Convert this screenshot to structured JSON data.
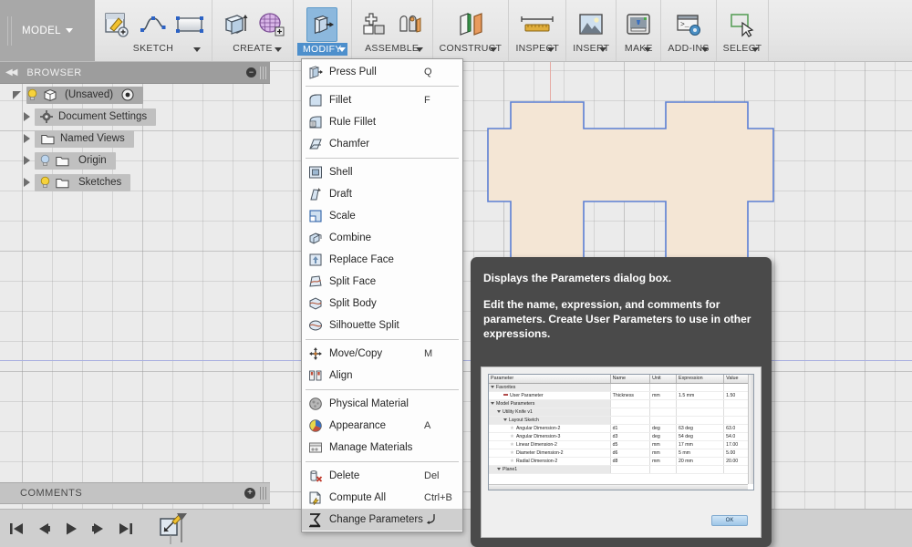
{
  "app": {
    "workspace_tab": "MODEL",
    "accent_blue": "#4d8fcc",
    "canvas_bg": "#ebebeb"
  },
  "toolbar": {
    "groups": [
      {
        "label": "SKETCH",
        "icons": [
          "create-sketch-icon",
          "spline-icon",
          "rectangle-icon"
        ]
      },
      {
        "label": "CREATE",
        "icons": [
          "extrude-icon",
          "form-icon"
        ]
      },
      {
        "label": "MODIFY",
        "icons": [
          "press-pull-icon"
        ],
        "active": true
      },
      {
        "label": "ASSEMBLE",
        "icons": [
          "new-component-icon",
          "joint-icon"
        ]
      },
      {
        "label": "CONSTRUCT",
        "icons": [
          "offset-plane-icon"
        ]
      },
      {
        "label": "INSPECT",
        "icons": [
          "measure-icon"
        ]
      },
      {
        "label": "INSERT",
        "icons": [
          "insert-image-icon"
        ]
      },
      {
        "label": "MAKE",
        "icons": [
          "3d-print-icon"
        ]
      },
      {
        "label": "ADD-INS",
        "icons": [
          "scripts-addins-icon"
        ]
      },
      {
        "label": "SELECT",
        "icons": [
          "select-window-icon"
        ]
      }
    ]
  },
  "browser": {
    "title": "BROWSER",
    "collapse_icon": "collapse-left-icon",
    "close_icon": "minus-circle-icon",
    "tree": [
      {
        "label": "(Unsaved)",
        "icon": "component-cube-icon",
        "bulb": "on",
        "expander": "expanded",
        "trailing_icon": "activate-target-icon",
        "indent": 0
      },
      {
        "label": "Document Settings",
        "icon": "gear-icon",
        "bulb": "none",
        "expander": "collapsed",
        "indent": 1
      },
      {
        "label": "Named Views",
        "icon": "folder-icon",
        "bulb": "none",
        "expander": "collapsed",
        "indent": 1
      },
      {
        "label": "Origin",
        "icon": "folder-icon",
        "bulb": "off",
        "expander": "collapsed",
        "indent": 1
      },
      {
        "label": "Sketches",
        "icon": "folder-icon",
        "bulb": "on",
        "expander": "collapsed",
        "indent": 1
      }
    ]
  },
  "comments": {
    "title": "COMMENTS",
    "add_icon": "plus-circle-icon"
  },
  "timeline": {
    "buttons": [
      "go-to-beginning-icon",
      "step-back-icon",
      "play-icon",
      "step-forward-icon",
      "go-to-end-icon"
    ],
    "feature_icon": "sketch-feature-icon"
  },
  "modify_menu": {
    "items": [
      {
        "label": "Press Pull",
        "shortcut": "Q",
        "icon": "press-pull-icon",
        "sep_after": true
      },
      {
        "label": "Fillet",
        "shortcut": "F",
        "icon": "fillet-icon"
      },
      {
        "label": "Rule Fillet",
        "shortcut": "",
        "icon": "rule-fillet-icon"
      },
      {
        "label": "Chamfer",
        "shortcut": "",
        "icon": "chamfer-icon",
        "sep_after": true
      },
      {
        "label": "Shell",
        "shortcut": "",
        "icon": "shell-icon"
      },
      {
        "label": "Draft",
        "shortcut": "",
        "icon": "draft-icon"
      },
      {
        "label": "Scale",
        "shortcut": "",
        "icon": "scale-icon"
      },
      {
        "label": "Combine",
        "shortcut": "",
        "icon": "combine-icon"
      },
      {
        "label": "Replace Face",
        "shortcut": "",
        "icon": "replace-face-icon"
      },
      {
        "label": "Split Face",
        "shortcut": "",
        "icon": "split-face-icon"
      },
      {
        "label": "Split Body",
        "shortcut": "",
        "icon": "split-body-icon"
      },
      {
        "label": "Silhouette Split",
        "shortcut": "",
        "icon": "silhouette-split-icon",
        "sep_after": true
      },
      {
        "label": "Move/Copy",
        "shortcut": "M",
        "icon": "move-copy-icon"
      },
      {
        "label": "Align",
        "shortcut": "",
        "icon": "align-icon",
        "sep_after": true
      },
      {
        "label": "Physical Material",
        "shortcut": "",
        "icon": "physical-material-icon"
      },
      {
        "label": "Appearance",
        "shortcut": "A",
        "icon": "appearance-icon"
      },
      {
        "label": "Manage Materials",
        "shortcut": "",
        "icon": "manage-materials-icon",
        "sep_after": true
      },
      {
        "label": "Delete",
        "shortcut": "Del",
        "icon": "delete-icon"
      },
      {
        "label": "Compute All",
        "shortcut": "Ctrl+B",
        "icon": "compute-all-icon"
      },
      {
        "label": "Change Parameters",
        "shortcut": "sigma-arrow",
        "icon": "change-parameters-icon",
        "highlighted": true
      }
    ]
  },
  "tooltip": {
    "title": "Displays the Parameters dialog box.",
    "description": "Edit the name, expression, and comments for parameters. Create User Parameters to use in other expressions.",
    "bg_color": "#4a4a4a",
    "preview": {
      "ok_button": "OK",
      "table": {
        "columns": [
          "Parameter",
          "Name",
          "Unit",
          "Expression",
          "Value"
        ],
        "rows": [
          {
            "kind": "group",
            "indent": 0,
            "parameter": "Favorites",
            "name": "",
            "unit": "",
            "expression": "",
            "value": ""
          },
          {
            "kind": "user",
            "indent": 2,
            "parameter": "User Parameter",
            "name": "Thickness",
            "unit": "mm",
            "expression": "1.5 mm",
            "value": "1.50"
          },
          {
            "kind": "group",
            "indent": 0,
            "parameter": "Model Parameters",
            "name": "",
            "unit": "",
            "expression": "",
            "value": ""
          },
          {
            "kind": "group",
            "indent": 1,
            "parameter": "Utility Knife v1",
            "name": "",
            "unit": "",
            "expression": "",
            "value": ""
          },
          {
            "kind": "group",
            "indent": 2,
            "parameter": "Layout Sketch",
            "name": "",
            "unit": "",
            "expression": "",
            "value": ""
          },
          {
            "kind": "param",
            "indent": 3,
            "parameter": "Angular Dimension-2",
            "name": "d1",
            "unit": "deg",
            "expression": "63 deg",
            "value": "63.0"
          },
          {
            "kind": "param",
            "indent": 3,
            "parameter": "Angular Dimension-3",
            "name": "d3",
            "unit": "deg",
            "expression": "54 deg",
            "value": "54.0"
          },
          {
            "kind": "param",
            "indent": 3,
            "parameter": "Linear Dimension-2",
            "name": "d5",
            "unit": "mm",
            "expression": "17 mm",
            "value": "17.00"
          },
          {
            "kind": "param",
            "indent": 3,
            "parameter": "Diameter Dimension-2",
            "name": "d6",
            "unit": "mm",
            "expression": "5 mm",
            "value": "5.00"
          },
          {
            "kind": "param",
            "indent": 3,
            "parameter": "Radial Dimension-2",
            "name": "d8",
            "unit": "mm",
            "expression": "20 mm",
            "value": "20.00"
          },
          {
            "kind": "group",
            "indent": 1,
            "parameter": "Plane1",
            "name": "",
            "unit": "",
            "expression": "",
            "value": ""
          }
        ]
      }
    }
  },
  "canvas": {
    "sketch_fill": "#f4e6d5",
    "sketch_stroke": "#5b7fd4",
    "x_axis_color": "#e5a9a2",
    "y_axis_color": "#a9b0e0"
  }
}
